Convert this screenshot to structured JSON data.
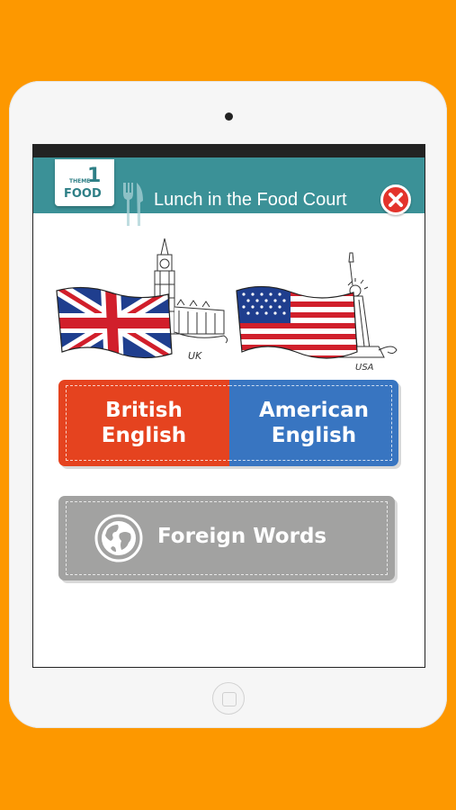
{
  "header": {
    "theme_word": "THEME",
    "theme_number": "1",
    "theme_name": "FOOD",
    "title": "Lunch in the Food Court"
  },
  "flags": {
    "uk_caption": "UK",
    "us_caption": "USA"
  },
  "buttons": {
    "british_line1": "British",
    "british_line2": "English",
    "american_line1": "American",
    "american_line2": "English",
    "foreign": "Foreign Words"
  },
  "icons": {
    "close": "close-icon",
    "utensils": "fork-knife-icon",
    "globe": "globe-icon"
  },
  "colors": {
    "background": "#FD9800",
    "header": "#3B9197",
    "british": "#E5431F",
    "american": "#3875C1",
    "foreign": "#A2A2A1",
    "close": "#E3332B"
  }
}
